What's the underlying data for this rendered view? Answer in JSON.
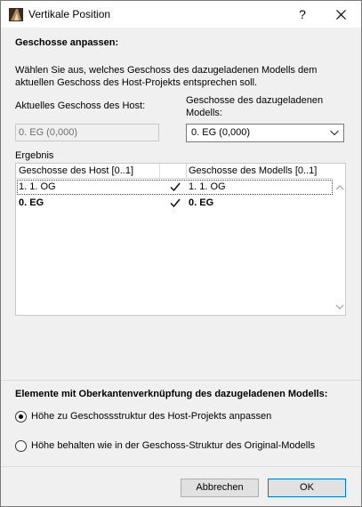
{
  "window": {
    "title": "Vertikale Position",
    "help_label": "?",
    "close_icon": "close-icon",
    "app_icon": "archicad-icon"
  },
  "section": {
    "heading": "Geschosse anpassen:",
    "description_line1": "Wählen Sie aus, welches Geschoss des dazugeladenen Modells dem",
    "description_line2": "aktuellen Geschoss des Host-Projekts entsprechen soll."
  },
  "host": {
    "label": "Aktuelles Geschoss des Host:",
    "value": "0. EG (0,000)"
  },
  "loaded": {
    "label_line1": "Geschosse des dazugeladenen",
    "label_line2": "Modells:",
    "selected": "0. EG (0,000)"
  },
  "result": {
    "label": "Ergebnis",
    "col_host": "Geschosse des Host [0..1]",
    "col_model": "Geschosse des Modells [0..1]",
    "rows": [
      {
        "host": "1. 1. OG",
        "model": "1. 1. OG",
        "bold": false,
        "selected": true
      },
      {
        "host": "0. EG",
        "model": "0. EG",
        "bold": true,
        "selected": false
      }
    ]
  },
  "elements": {
    "heading": "Elemente mit Oberkantenverknüpfung des dazugeladenen Modells:",
    "options": [
      {
        "label": "Höhe zu Geschossstruktur des Host-Projekts anpassen",
        "checked": true
      },
      {
        "label": "Höhe behalten wie in der Geschoss-Struktur des Original-Modells",
        "checked": false
      }
    ]
  },
  "buttons": {
    "cancel": "Abbrechen",
    "ok": "OK"
  },
  "colors": {
    "accent": "#0078d7",
    "background": "#f0f0f0"
  }
}
